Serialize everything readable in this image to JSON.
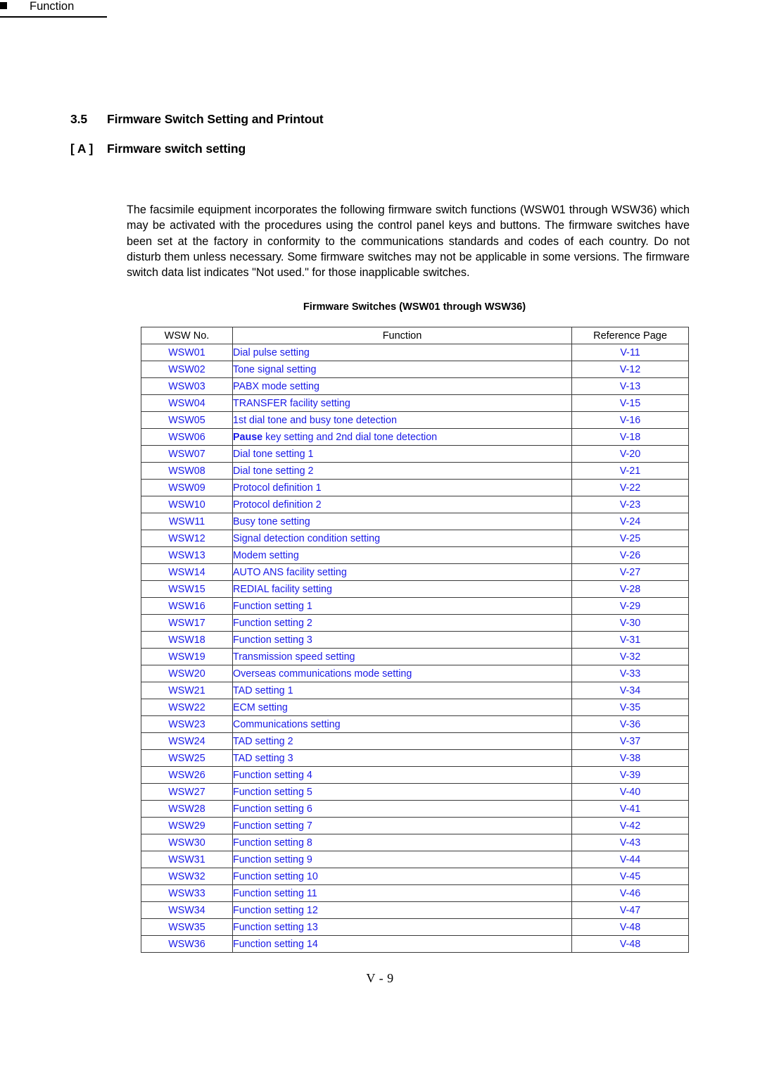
{
  "document": {
    "section_number": "3.5",
    "section_title": "Firmware Switch Setting and Printout",
    "subsection_tag": "[ A ]",
    "subsection_title": "Firmware switch setting",
    "function_heading": "Function",
    "footer": "V - 9",
    "link_color": "#1a1ae8",
    "text_color": "#000000"
  },
  "body": {
    "paragraph": "The facsimile equipment incorporates the following firmware switch functions (WSW01 through WSW36) which may be activated with the procedures using the control panel keys and buttons. The firmware switches have been set at the factory in conformity to the communications standards and codes of each country.  Do not disturb them unless necessary.  Some firmware switches may not be applicable in some versions.  The firmware switch data list indicates \"Not used.\" for those inapplicable switches."
  },
  "table": {
    "caption": "Firmware Switches (WSW01 through WSW36)",
    "columns": [
      "WSW No.",
      "Function",
      "Reference Page"
    ],
    "rows": [
      {
        "no": "WSW01",
        "function": "Dial pulse setting",
        "function_bold": "",
        "function_rest": "",
        "ref": "V-11"
      },
      {
        "no": "WSW02",
        "function": "Tone signal setting",
        "function_bold": "",
        "function_rest": "",
        "ref": "V-12"
      },
      {
        "no": "WSW03",
        "function": "PABX mode setting",
        "function_bold": "",
        "function_rest": "",
        "ref": "V-13"
      },
      {
        "no": "WSW04",
        "function": "TRANSFER facility setting",
        "function_bold": "",
        "function_rest": "",
        "ref": "V-15"
      },
      {
        "no": "WSW05",
        "function": "1st dial tone and busy tone detection",
        "function_bold": "",
        "function_rest": "",
        "ref": "V-16"
      },
      {
        "no": "WSW06",
        "function": "Pause key setting and 2nd dial tone detection",
        "function_bold": "Pause",
        "function_rest": " key setting and 2nd dial tone detection",
        "ref": "V-18"
      },
      {
        "no": "WSW07",
        "function": "Dial tone setting 1",
        "function_bold": "",
        "function_rest": "",
        "ref": "V-20"
      },
      {
        "no": "WSW08",
        "function": "Dial tone setting 2",
        "function_bold": "",
        "function_rest": "",
        "ref": "V-21"
      },
      {
        "no": "WSW09",
        "function": "Protocol definition 1",
        "function_bold": "",
        "function_rest": "",
        "ref": "V-22"
      },
      {
        "no": "WSW10",
        "function": "Protocol definition 2",
        "function_bold": "",
        "function_rest": "",
        "ref": "V-23"
      },
      {
        "no": "WSW11",
        "function": "Busy tone setting",
        "function_bold": "",
        "function_rest": "",
        "ref": "V-24"
      },
      {
        "no": "WSW12",
        "function": "Signal detection condition setting",
        "function_bold": "",
        "function_rest": "",
        "ref": "V-25"
      },
      {
        "no": "WSW13",
        "function": "Modem setting",
        "function_bold": "",
        "function_rest": "",
        "ref": "V-26"
      },
      {
        "no": "WSW14",
        "function": "AUTO ANS facility setting",
        "function_bold": "",
        "function_rest": "",
        "ref": "V-27"
      },
      {
        "no": "WSW15",
        "function": "REDIAL facility setting",
        "function_bold": "",
        "function_rest": "",
        "ref": "V-28"
      },
      {
        "no": "WSW16",
        "function": "Function setting 1",
        "function_bold": "",
        "function_rest": "",
        "ref": "V-29"
      },
      {
        "no": "WSW17",
        "function": "Function setting 2",
        "function_bold": "",
        "function_rest": "",
        "ref": "V-30"
      },
      {
        "no": "WSW18",
        "function": "Function setting 3",
        "function_bold": "",
        "function_rest": "",
        "ref": "V-31"
      },
      {
        "no": "WSW19",
        "function": "Transmission speed setting",
        "function_bold": "",
        "function_rest": "",
        "ref": "V-32"
      },
      {
        "no": "WSW20",
        "function": "Overseas communications mode setting",
        "function_bold": "",
        "function_rest": "",
        "ref": "V-33"
      },
      {
        "no": "WSW21",
        "function": "TAD setting 1",
        "function_bold": "",
        "function_rest": "",
        "ref": "V-34"
      },
      {
        "no": "WSW22",
        "function": "ECM setting",
        "function_bold": "",
        "function_rest": "",
        "ref": "V-35"
      },
      {
        "no": "WSW23",
        "function": "Communications setting",
        "function_bold": "",
        "function_rest": "",
        "ref": "V-36"
      },
      {
        "no": "WSW24",
        "function": "TAD setting 2",
        "function_bold": "",
        "function_rest": "",
        "ref": "V-37"
      },
      {
        "no": "WSW25",
        "function": "TAD setting 3",
        "function_bold": "",
        "function_rest": "",
        "ref": "V-38"
      },
      {
        "no": "WSW26",
        "function": "Function setting 4",
        "function_bold": "",
        "function_rest": "",
        "ref": "V-39"
      },
      {
        "no": "WSW27",
        "function": "Function setting 5",
        "function_bold": "",
        "function_rest": "",
        "ref": "V-40"
      },
      {
        "no": "WSW28",
        "function": "Function setting 6",
        "function_bold": "",
        "function_rest": "",
        "ref": "V-41"
      },
      {
        "no": "WSW29",
        "function": "Function setting 7",
        "function_bold": "",
        "function_rest": "",
        "ref": "V-42"
      },
      {
        "no": "WSW30",
        "function": "Function setting 8",
        "function_bold": "",
        "function_rest": "",
        "ref": "V-43"
      },
      {
        "no": "WSW31",
        "function": "Function setting 9",
        "function_bold": "",
        "function_rest": "",
        "ref": "V-44"
      },
      {
        "no": "WSW32",
        "function": "Function setting 10",
        "function_bold": "",
        "function_rest": "",
        "ref": "V-45"
      },
      {
        "no": "WSW33",
        "function": "Function setting 11",
        "function_bold": "",
        "function_rest": "",
        "ref": "V-46"
      },
      {
        "no": "WSW34",
        "function": "Function setting 12",
        "function_bold": "",
        "function_rest": "",
        "ref": "V-47"
      },
      {
        "no": "WSW35",
        "function": "Function setting 13",
        "function_bold": "",
        "function_rest": "",
        "ref": "V-48"
      },
      {
        "no": "WSW36",
        "function": "Function setting 14",
        "function_bold": "",
        "function_rest": "",
        "ref": "V-48"
      }
    ]
  }
}
